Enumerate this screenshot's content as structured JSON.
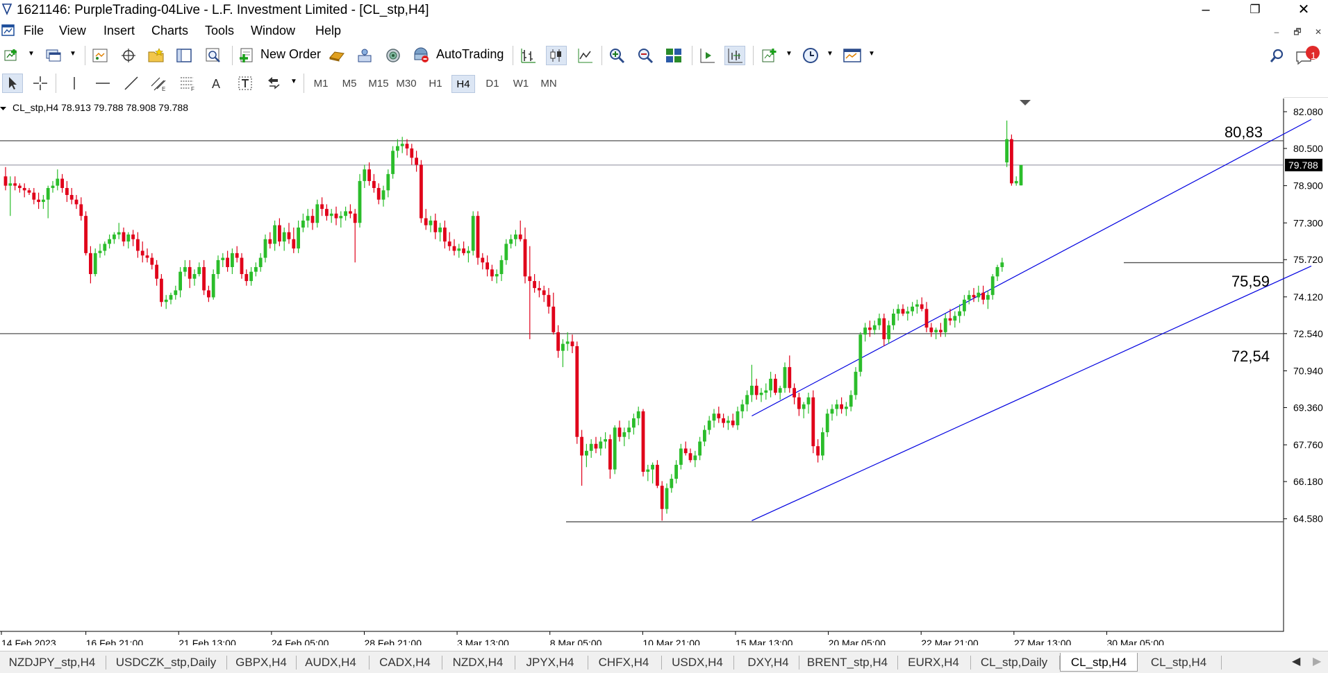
{
  "window": {
    "title": "1621146: PurpleTrading-04Live - L.F. Investment Limited - [CL_stp,H4]",
    "controls": [
      "–",
      "❐",
      "✕"
    ]
  },
  "menu": {
    "items": [
      "File",
      "View",
      "Insert",
      "Charts",
      "Tools",
      "Window",
      "Help"
    ],
    "mdi_controls": [
      "–",
      "🗗",
      "✕"
    ]
  },
  "toolbar": {
    "new_order_label": "New Order",
    "autotrading_label": "AutoTrading",
    "notification_count": "1"
  },
  "timeframes": {
    "items": [
      "M1",
      "M5",
      "M15",
      "M30",
      "H1",
      "H4",
      "D1",
      "W1",
      "MN"
    ],
    "active": "H4"
  },
  "chart": {
    "info": "CL_stp,H4  78.913 79.788 78.908 79.788",
    "current_price": "79.788",
    "level_labels": {
      "upper": "80,83",
      "middle": "75,59",
      "lower": "72,54"
    }
  },
  "chart_data": {
    "type": "candlestick",
    "symbol": "CL_stp",
    "timeframe": "H4",
    "y_ticks": [
      "82.080",
      "80.500",
      "78.900",
      "77.300",
      "75.720",
      "74.120",
      "72.540",
      "70.940",
      "69.360",
      "67.760",
      "66.180",
      "64.580"
    ],
    "x_ticks": [
      "14 Feb 2023",
      "16 Feb 21:00",
      "21 Feb 13:00",
      "24 Feb 05:00",
      "28 Feb 21:00",
      "3 Mar 13:00",
      "8 Mar 05:00",
      "10 Mar 21:00",
      "15 Mar 13:00",
      "20 Mar 05:00",
      "22 Mar 21:00",
      "27 Mar 13:00",
      "30 Mar 05:00"
    ],
    "ylim": [
      63.8,
      82.5
    ],
    "horizontal_lines": [
      80.83,
      75.59,
      72.54,
      64.45
    ],
    "current_price": 79.788,
    "channel": {
      "upper": [
        {
          "bar": 158,
          "price": 69.0
        },
        {
          "bar": 250,
          "price": 78.9
        }
      ],
      "lower": [
        {
          "bar": 158,
          "price": 64.5
        },
        {
          "bar": 250,
          "price": 73.0
        }
      ]
    },
    "candles": [
      [
        79.3,
        79.7,
        78.7,
        78.9
      ],
      [
        78.9,
        79.3,
        77.6,
        79.0
      ],
      [
        79.0,
        79.3,
        78.7,
        78.9
      ],
      [
        78.9,
        79.0,
        78.6,
        78.8
      ],
      [
        78.8,
        79.0,
        78.4,
        78.7
      ],
      [
        78.7,
        78.8,
        78.5,
        78.6
      ],
      [
        78.6,
        78.8,
        78.1,
        78.3
      ],
      [
        78.3,
        78.6,
        77.9,
        78.2
      ],
      [
        78.2,
        78.5,
        77.9,
        78.3
      ],
      [
        78.3,
        78.9,
        77.5,
        78.8
      ],
      [
        78.8,
        79.1,
        78.6,
        78.9
      ],
      [
        78.9,
        79.6,
        78.7,
        79.2
      ],
      [
        79.2,
        79.4,
        78.6,
        78.8
      ],
      [
        78.8,
        79.1,
        78.2,
        78.5
      ],
      [
        78.5,
        78.8,
        78.1,
        78.3
      ],
      [
        78.3,
        78.5,
        77.9,
        78.1
      ],
      [
        78.1,
        78.4,
        77.4,
        77.6
      ],
      [
        77.6,
        77.8,
        75.9,
        76.0
      ],
      [
        76.0,
        76.3,
        74.7,
        75.1
      ],
      [
        75.1,
        76.2,
        75.0,
        76.0
      ],
      [
        76.0,
        76.4,
        75.8,
        76.1
      ],
      [
        76.1,
        76.5,
        75.9,
        76.4
      ],
      [
        76.4,
        76.8,
        76.2,
        76.6
      ],
      [
        76.6,
        76.9,
        76.4,
        76.8
      ],
      [
        76.8,
        77.3,
        76.6,
        76.9
      ],
      [
        76.9,
        77.1,
        76.3,
        76.5
      ],
      [
        76.5,
        76.9,
        76.2,
        76.8
      ],
      [
        76.8,
        77.0,
        76.3,
        76.6
      ],
      [
        76.6,
        76.9,
        75.8,
        76.1
      ],
      [
        76.1,
        76.5,
        75.6,
        75.9
      ],
      [
        75.9,
        76.2,
        75.6,
        75.8
      ],
      [
        75.8,
        76.0,
        75.3,
        75.5
      ],
      [
        75.5,
        75.7,
        74.6,
        74.9
      ],
      [
        74.9,
        75.1,
        73.7,
        73.9
      ],
      [
        73.9,
        74.2,
        73.6,
        74.0
      ],
      [
        74.0,
        74.3,
        73.8,
        74.2
      ],
      [
        74.2,
        74.6,
        74.0,
        74.4
      ],
      [
        74.4,
        75.4,
        74.1,
        75.2
      ],
      [
        75.2,
        75.7,
        75.0,
        75.4
      ],
      [
        75.4,
        75.7,
        74.5,
        74.9
      ],
      [
        74.9,
        75.3,
        74.6,
        75.1
      ],
      [
        75.1,
        75.6,
        75.0,
        75.4
      ],
      [
        75.4,
        75.7,
        74.2,
        74.4
      ],
      [
        74.4,
        74.6,
        73.9,
        74.1
      ],
      [
        74.1,
        75.3,
        74.0,
        75.1
      ],
      [
        75.1,
        75.9,
        74.9,
        75.7
      ],
      [
        75.7,
        76.0,
        75.4,
        75.8
      ],
      [
        75.8,
        76.1,
        75.2,
        75.4
      ],
      [
        75.4,
        76.2,
        75.1,
        76.0
      ],
      [
        76.0,
        76.3,
        75.6,
        75.8
      ],
      [
        75.8,
        76.0,
        74.9,
        75.1
      ],
      [
        75.1,
        75.3,
        74.6,
        74.8
      ],
      [
        74.8,
        75.4,
        74.6,
        75.2
      ],
      [
        75.2,
        75.6,
        75.0,
        75.4
      ],
      [
        75.4,
        76.0,
        75.2,
        75.8
      ],
      [
        75.8,
        76.8,
        75.6,
        76.6
      ],
      [
        76.6,
        76.9,
        76.2,
        76.4
      ],
      [
        76.4,
        77.4,
        76.1,
        77.2
      ],
      [
        77.2,
        77.5,
        76.3,
        76.5
      ],
      [
        76.5,
        77.1,
        76.1,
        76.9
      ],
      [
        76.9,
        77.3,
        76.4,
        76.6
      ],
      [
        76.6,
        77.1,
        76.0,
        76.2
      ],
      [
        76.2,
        77.4,
        76.0,
        77.1
      ],
      [
        77.1,
        77.7,
        76.9,
        77.4
      ],
      [
        77.4,
        77.9,
        77.1,
        77.6
      ],
      [
        77.6,
        77.9,
        77.0,
        77.3
      ],
      [
        77.3,
        78.3,
        77.1,
        78.1
      ],
      [
        78.1,
        78.4,
        77.6,
        77.9
      ],
      [
        77.9,
        78.1,
        77.4,
        77.6
      ],
      [
        77.6,
        77.9,
        77.3,
        77.7
      ],
      [
        77.7,
        78.0,
        77.2,
        77.5
      ],
      [
        77.5,
        77.8,
        77.1,
        77.6
      ],
      [
        77.6,
        78.0,
        77.4,
        77.8
      ],
      [
        77.8,
        78.1,
        77.5,
        77.7
      ],
      [
        77.7,
        77.9,
        75.6,
        77.3
      ],
      [
        77.3,
        79.4,
        77.1,
        79.1
      ],
      [
        79.1,
        79.8,
        78.8,
        79.6
      ],
      [
        79.6,
        79.9,
        78.9,
        79.1
      ],
      [
        79.1,
        79.4,
        78.6,
        78.8
      ],
      [
        78.8,
        79.0,
        78.1,
        78.3
      ],
      [
        78.3,
        78.9,
        78.0,
        78.7
      ],
      [
        78.7,
        79.6,
        78.4,
        79.4
      ],
      [
        79.4,
        80.6,
        79.2,
        80.4
      ],
      [
        80.4,
        80.9,
        80.1,
        80.6
      ],
      [
        80.6,
        81.0,
        80.3,
        80.7
      ],
      [
        80.7,
        80.9,
        80.2,
        80.5
      ],
      [
        80.5,
        80.7,
        79.8,
        80.1
      ],
      [
        80.1,
        80.4,
        79.5,
        79.8
      ],
      [
        79.8,
        80.0,
        77.3,
        77.5
      ],
      [
        77.5,
        77.9,
        77.0,
        77.2
      ],
      [
        77.2,
        77.6,
        76.9,
        77.4
      ],
      [
        77.4,
        77.7,
        76.6,
        76.9
      ],
      [
        76.9,
        77.3,
        76.5,
        77.1
      ],
      [
        77.1,
        77.4,
        76.2,
        76.5
      ],
      [
        76.5,
        76.9,
        76.1,
        76.3
      ],
      [
        76.3,
        76.6,
        75.9,
        76.1
      ],
      [
        76.1,
        76.4,
        75.8,
        76.2
      ],
      [
        76.2,
        76.5,
        75.9,
        76.0
      ],
      [
        76.0,
        76.3,
        75.6,
        76.1
      ],
      [
        76.1,
        77.8,
        75.9,
        77.6
      ],
      [
        77.6,
        77.8,
        75.5,
        75.8
      ],
      [
        75.8,
        76.0,
        75.3,
        75.6
      ],
      [
        75.6,
        75.9,
        75.0,
        75.3
      ],
      [
        75.3,
        75.5,
        74.8,
        75.0
      ],
      [
        75.0,
        75.3,
        74.7,
        75.1
      ],
      [
        75.1,
        75.9,
        74.8,
        75.7
      ],
      [
        75.7,
        76.6,
        75.5,
        76.4
      ],
      [
        76.4,
        76.8,
        76.2,
        76.6
      ],
      [
        76.6,
        77.0,
        76.3,
        76.8
      ],
      [
        76.8,
        77.4,
        76.5,
        76.6
      ],
      [
        76.6,
        77.1,
        74.7,
        75.0
      ],
      [
        75.0,
        76.3,
        72.3,
        74.8
      ],
      [
        74.8,
        75.1,
        74.3,
        74.5
      ],
      [
        74.5,
        74.8,
        74.1,
        74.4
      ],
      [
        74.4,
        74.6,
        73.9,
        74.2
      ],
      [
        74.2,
        74.5,
        73.4,
        73.7
      ],
      [
        73.7,
        74.3,
        72.5,
        72.6
      ],
      [
        72.6,
        72.9,
        71.5,
        71.8
      ],
      [
        71.8,
        72.3,
        71.1,
        72.1
      ],
      [
        72.1,
        72.6,
        71.8,
        72.2
      ],
      [
        72.2,
        72.5,
        71.7,
        72.0
      ],
      [
        72.0,
        72.2,
        67.8,
        68.1
      ],
      [
        68.1,
        68.4,
        66.0,
        67.3
      ],
      [
        67.3,
        67.8,
        66.8,
        67.5
      ],
      [
        67.5,
        68.0,
        67.2,
        67.8
      ],
      [
        67.8,
        68.1,
        67.4,
        67.6
      ],
      [
        67.6,
        68.1,
        67.3,
        67.9
      ],
      [
        67.9,
        68.3,
        67.6,
        68.0
      ],
      [
        68.0,
        68.2,
        66.3,
        66.7
      ],
      [
        66.7,
        68.6,
        66.5,
        68.5
      ],
      [
        68.5,
        68.8,
        67.9,
        68.1
      ],
      [
        68.1,
        68.5,
        67.7,
        68.3
      ],
      [
        68.3,
        68.8,
        68.0,
        68.5
      ],
      [
        68.5,
        69.1,
        68.2,
        68.9
      ],
      [
        68.9,
        69.4,
        68.6,
        69.2
      ],
      [
        69.2,
        69.3,
        66.4,
        66.6
      ],
      [
        66.6,
        66.9,
        66.2,
        66.7
      ],
      [
        66.7,
        67.0,
        66.1,
        66.9
      ],
      [
        66.9,
        67.1,
        65.9,
        66.0
      ],
      [
        66.0,
        66.2,
        64.5,
        65.0
      ],
      [
        65.0,
        66.1,
        64.8,
        65.9
      ],
      [
        65.9,
        66.5,
        65.7,
        66.3
      ],
      [
        66.3,
        67.1,
        66.1,
        66.9
      ],
      [
        66.9,
        67.8,
        66.7,
        67.6
      ],
      [
        67.6,
        67.9,
        67.3,
        67.4
      ],
      [
        67.4,
        67.6,
        67.0,
        67.1
      ],
      [
        67.1,
        67.5,
        66.8,
        67.3
      ],
      [
        67.3,
        68.1,
        67.1,
        67.9
      ],
      [
        67.9,
        68.6,
        67.7,
        68.4
      ],
      [
        68.4,
        69.0,
        68.2,
        68.8
      ],
      [
        68.8,
        69.3,
        68.5,
        69.1
      ],
      [
        69.1,
        69.4,
        68.7,
        68.9
      ],
      [
        68.9,
        69.1,
        68.5,
        68.7
      ],
      [
        68.7,
        69.0,
        68.4,
        68.8
      ],
      [
        68.8,
        69.1,
        68.5,
        68.6
      ],
      [
        68.6,
        69.4,
        68.4,
        69.2
      ],
      [
        69.2,
        69.7,
        68.9,
        69.5
      ],
      [
        69.5,
        70.1,
        69.2,
        69.9
      ],
      [
        69.9,
        71.2,
        69.6,
        70.3
      ],
      [
        70.3,
        70.6,
        69.7,
        69.9
      ],
      [
        69.9,
        70.2,
        69.6,
        70.0
      ],
      [
        70.0,
        70.4,
        69.7,
        70.1
      ],
      [
        70.1,
        70.9,
        69.8,
        70.6
      ],
      [
        70.6,
        70.8,
        69.9,
        70.0
      ],
      [
        70.0,
        70.3,
        69.7,
        70.2
      ],
      [
        70.2,
        71.3,
        70.0,
        71.1
      ],
      [
        71.1,
        71.6,
        70.0,
        70.2
      ],
      [
        70.2,
        70.4,
        69.5,
        69.8
      ],
      [
        69.8,
        70.0,
        69.0,
        69.3
      ],
      [
        69.3,
        69.6,
        68.9,
        69.5
      ],
      [
        69.5,
        70.0,
        69.1,
        69.8
      ],
      [
        69.8,
        70.1,
        67.4,
        67.7
      ],
      [
        67.7,
        68.0,
        67.0,
        67.3
      ],
      [
        67.3,
        68.5,
        67.1,
        68.3
      ],
      [
        68.3,
        69.3,
        68.1,
        69.1
      ],
      [
        69.1,
        69.5,
        68.8,
        69.3
      ],
      [
        69.3,
        69.7,
        69.0,
        69.5
      ],
      [
        69.5,
        69.8,
        69.1,
        69.3
      ],
      [
        69.3,
        69.6,
        69.0,
        69.4
      ],
      [
        69.4,
        70.1,
        69.2,
        69.9
      ],
      [
        69.9,
        71.1,
        69.7,
        70.9
      ],
      [
        70.9,
        72.6,
        70.7,
        72.5
      ],
      [
        72.5,
        73.0,
        72.2,
        72.8
      ],
      [
        72.8,
        73.1,
        72.4,
        72.7
      ],
      [
        72.7,
        73.1,
        72.5,
        72.9
      ],
      [
        72.9,
        73.4,
        72.7,
        73.2
      ],
      [
        73.2,
        73.4,
        72.0,
        72.3
      ],
      [
        72.3,
        73.1,
        72.1,
        72.9
      ],
      [
        72.9,
        73.6,
        72.7,
        73.4
      ],
      [
        73.4,
        73.8,
        73.1,
        73.6
      ],
      [
        73.6,
        73.8,
        73.3,
        73.4
      ],
      [
        73.4,
        73.7,
        73.1,
        73.5
      ],
      [
        73.5,
        73.9,
        73.3,
        73.7
      ],
      [
        73.7,
        74.0,
        73.4,
        73.8
      ],
      [
        73.8,
        74.1,
        73.5,
        73.6
      ],
      [
        73.6,
        73.9,
        72.6,
        72.8
      ],
      [
        72.8,
        73.0,
        72.4,
        72.6
      ],
      [
        72.6,
        72.8,
        72.3,
        72.7
      ],
      [
        72.7,
        73.0,
        72.4,
        72.6
      ],
      [
        72.6,
        73.4,
        72.4,
        73.2
      ],
      [
        73.2,
        73.6,
        72.9,
        73.1
      ],
      [
        73.1,
        73.5,
        72.8,
        73.3
      ],
      [
        73.3,
        73.8,
        73.0,
        73.5
      ],
      [
        73.5,
        74.2,
        73.3,
        74.0
      ],
      [
        74.0,
        74.4,
        73.8,
        74.2
      ],
      [
        74.2,
        74.5,
        73.9,
        74.1
      ],
      [
        74.1,
        74.6,
        73.9,
        74.3
      ],
      [
        74.3,
        74.6,
        73.8,
        74.0
      ],
      [
        74.0,
        74.4,
        73.6,
        74.2
      ],
      [
        74.2,
        75.1,
        74.0,
        75.0
      ],
      [
        75.0,
        75.5,
        74.8,
        75.4
      ],
      [
        75.4,
        75.8,
        75.2,
        75.6
      ],
      [
        79.9,
        81.7,
        79.7,
        80.9
      ],
      [
        80.9,
        81.1,
        78.9,
        79.0
      ],
      [
        79.0,
        79.3,
        78.9,
        79.1
      ],
      [
        78.913,
        79.788,
        78.908,
        79.788
      ]
    ]
  },
  "tabs": {
    "items": [
      "NZDJPY_stp,H4",
      "USDCZK_stp,Daily",
      "GBPX,H4",
      "AUDX,H4",
      "CADX,H4",
      "NZDX,H4",
      "JPYX,H4",
      "CHFX,H4",
      "USDX,H4",
      "DXY,H4",
      "BRENT_stp,H4",
      "EURX,H4",
      "CL_stp,Daily",
      "CL_stp,H4",
      "CL_stp,H4"
    ],
    "active_index": 13,
    "nav_left": "◀",
    "nav_right": "▶"
  },
  "colors": {
    "bull": "#2bbd2b",
    "bear": "#e0001a",
    "channel": "#0000e0",
    "level_line": "#505050",
    "price_line": "#8a8a9a"
  }
}
